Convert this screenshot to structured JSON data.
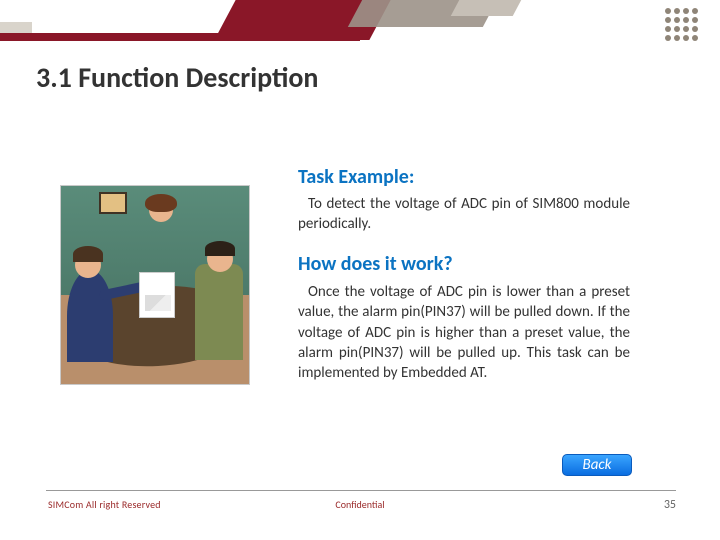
{
  "title": "3.1 Function Description",
  "task_heading": "Task Example:",
  "task_body": "To detect the voltage of ADC pin of SIM800 module periodically.",
  "how_heading": "How does it work?",
  "how_body": "Once the voltage of ADC pin is lower than a preset value, the alarm pin(PIN37)  will be pulled down. If the voltage of ADC pin is higher than a preset value, the alarm pin(PIN37)  will be pulled up. This task can be implemented by Embedded AT.",
  "back_label": "Back",
  "footer_left": "SIMCom All right Reserved",
  "footer_center": "Confidential",
  "page_number": "35"
}
